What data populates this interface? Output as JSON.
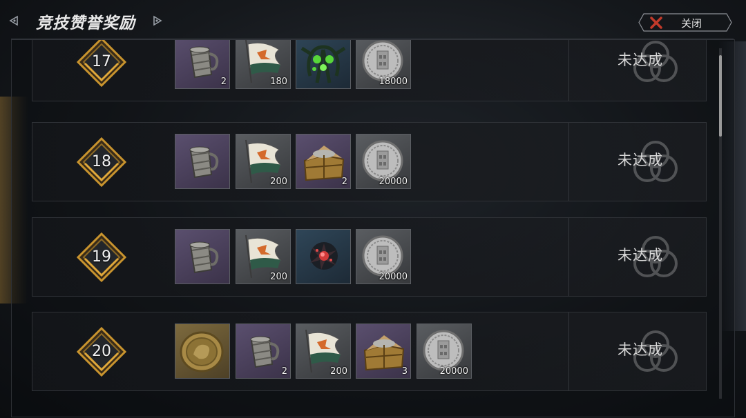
{
  "header": {
    "title": "竞技赞誉奖励",
    "close_label": "关闭"
  },
  "colors": {
    "badge_gold": "#c9942e",
    "close_red": "#c23a2a",
    "panel_border": "#2f3237"
  },
  "rows": [
    {
      "level": "17",
      "status": "未达成",
      "items": [
        {
          "icon": "tankard-icon",
          "frame": "purple",
          "qty": "2"
        },
        {
          "icon": "banner-icon",
          "frame": "grey",
          "qty": "180"
        },
        {
          "icon": "eldritch-creature-icon",
          "frame": "blue",
          "qty": ""
        },
        {
          "icon": "silver-coin-icon",
          "frame": "grey",
          "qty": "18000"
        }
      ]
    },
    {
      "level": "18",
      "status": "未达成",
      "items": [
        {
          "icon": "tankard-icon",
          "frame": "purple",
          "qty": ""
        },
        {
          "icon": "banner-icon",
          "frame": "grey",
          "qty": "200"
        },
        {
          "icon": "treasure-chest-icon",
          "frame": "purple",
          "qty": "2"
        },
        {
          "icon": "silver-coin-icon",
          "frame": "grey",
          "qty": "20000"
        }
      ]
    },
    {
      "level": "19",
      "status": "未达成",
      "items": [
        {
          "icon": "tankard-icon",
          "frame": "purple",
          "qty": ""
        },
        {
          "icon": "banner-icon",
          "frame": "grey",
          "qty": "200"
        },
        {
          "icon": "ember-blast-icon",
          "frame": "blue",
          "qty": ""
        },
        {
          "icon": "silver-coin-icon",
          "frame": "grey",
          "qty": "20000"
        }
      ]
    },
    {
      "level": "20",
      "status": "未达成",
      "items": [
        {
          "icon": "gold-medallion-icon",
          "frame": "gold",
          "qty": ""
        },
        {
          "icon": "tankard-icon",
          "frame": "purple",
          "qty": "2"
        },
        {
          "icon": "banner-icon",
          "frame": "grey",
          "qty": "200"
        },
        {
          "icon": "treasure-chest-icon",
          "frame": "purple",
          "qty": "3"
        },
        {
          "icon": "silver-coin-icon",
          "frame": "grey",
          "qty": "20000"
        }
      ]
    }
  ]
}
